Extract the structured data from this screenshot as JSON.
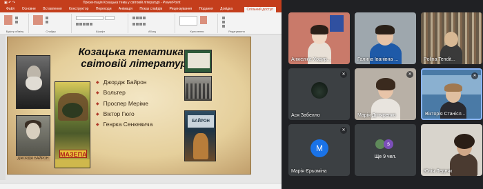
{
  "ppt": {
    "title": "Презентація Козацька тема у світовій літературі - PowerPoint",
    "tabs": [
      "Файл",
      "Основне",
      "Вставлення",
      "Конструктор",
      "Переходи",
      "Анімація",
      "Показ слайдів",
      "Рецензування",
      "Подання",
      "Довідка"
    ],
    "share_label": "Спільний доступ",
    "ribbon_groups": [
      "Буфер обміну",
      "Слайди",
      "Шрифт",
      "Абзац",
      "Креслення",
      "Редагування"
    ],
    "slide": {
      "title": "Козацька тематика у світовій літературі",
      "list": [
        "Джордж Байрон",
        "Вольтер",
        "Проспер Меріме",
        "Віктор Гюго",
        "Генрка Сенкевича"
      ],
      "hugo_caption": "Віктор Гюго",
      "byron_caption": "ДЖОРДЖ БАЙРОН",
      "mazepa_label": "МАЗЕПА",
      "book_r3_title": "БАЙРОН"
    }
  },
  "meet": {
    "participants": [
      {
        "name": "Анжеліка Ходир...",
        "type": "video",
        "muted": false
      },
      {
        "name": "Галина Іванівна ...",
        "type": "video",
        "muted": false
      },
      {
        "name": "Polina Tendit...",
        "type": "video",
        "muted": false
      },
      {
        "name": "Ася Забелло",
        "type": "camera-off",
        "muted": true
      },
      {
        "name": "Марія Дігтяренко",
        "type": "video",
        "muted": true
      },
      {
        "name": "Вікторія Станісл...",
        "type": "video",
        "muted": true,
        "active": true
      },
      {
        "name": "Марія Єрьоміна",
        "type": "avatar",
        "initial": "M",
        "muted": true
      },
      {
        "name": "Ще 9 чел.",
        "type": "more",
        "initial": "s"
      },
      {
        "name": "Юлія Ледняк",
        "type": "video",
        "muted": false
      }
    ],
    "mute_icon": "muted-mic-icon",
    "more_icon": "more-vert-icon"
  }
}
